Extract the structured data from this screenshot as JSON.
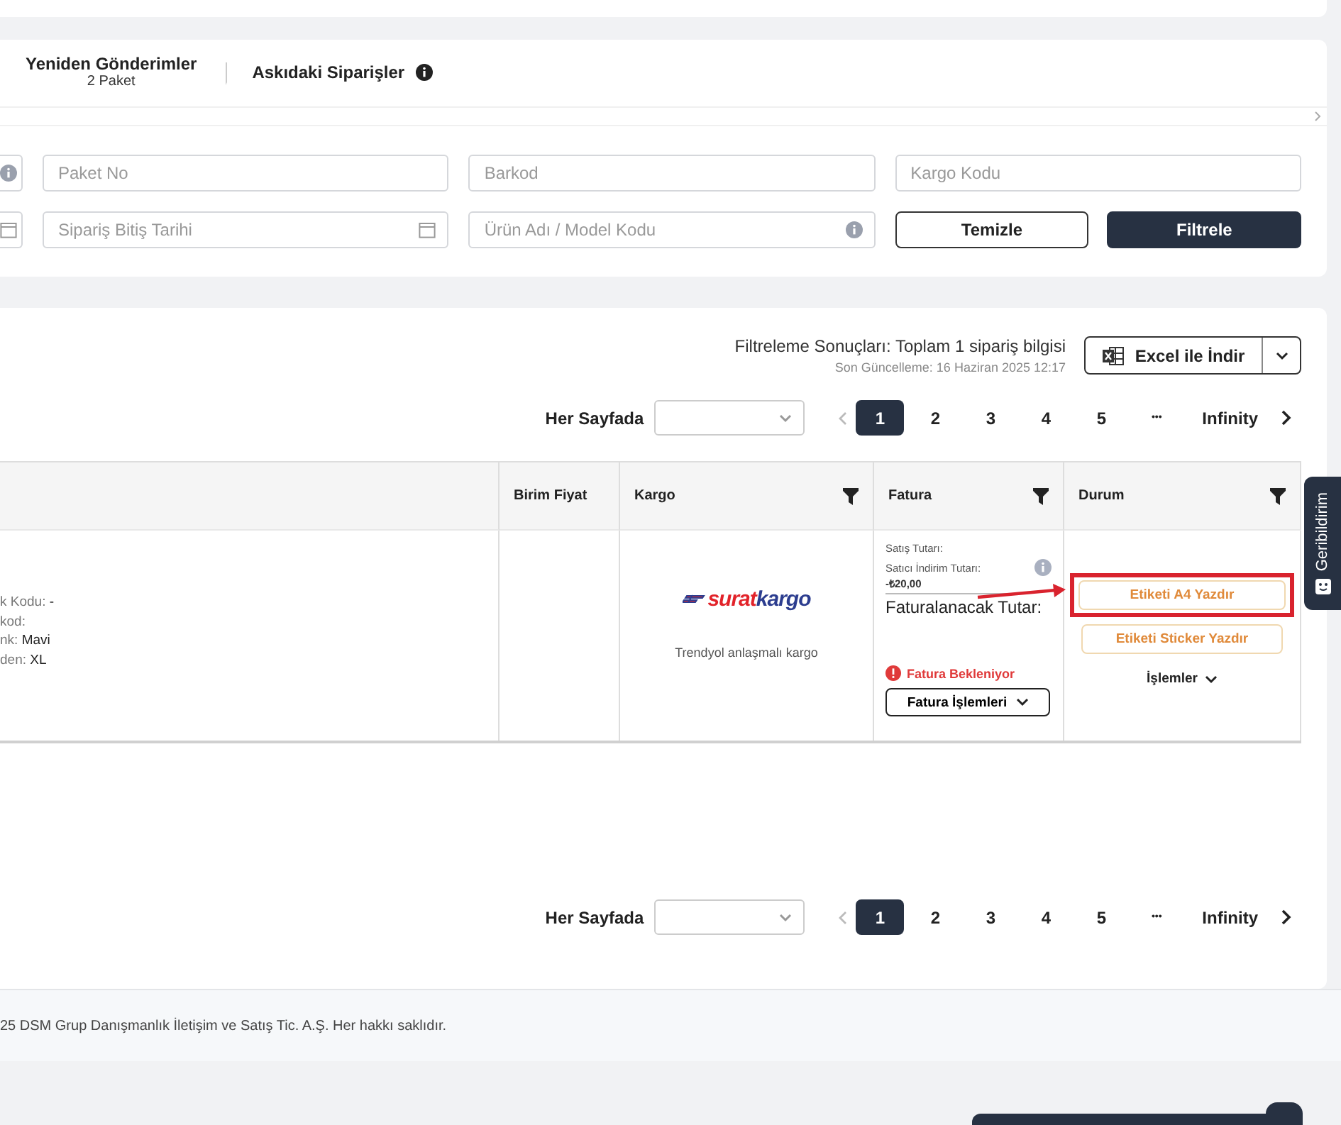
{
  "tabs": [
    {
      "kind": "count",
      "label": "Yeniden Gönderimler",
      "count": "2 Paket",
      "selected": false
    },
    {
      "kind": "info",
      "label": "Askıdaki Siparişler",
      "selected": false
    }
  ],
  "filters": [
    [
      {
        "kind": "cut_info"
      },
      {
        "kind": "text",
        "placeholder": "Paket No"
      },
      {
        "kind": "text",
        "placeholder": "Barkod"
      },
      {
        "kind": "text",
        "placeholder": "Kargo Kodu"
      }
    ],
    [
      {
        "kind": "cut_date"
      },
      {
        "kind": "date",
        "placeholder": "Sipariş Bitiş Tarihi"
      },
      {
        "kind": "info",
        "placeholder": "Ürün Adı / Model Kodu"
      },
      {
        "kind": "buttons",
        "buttons": [
          {
            "kind": "secondary",
            "label": "Temizle"
          },
          {
            "kind": "primary",
            "label": "Filtrele"
          }
        ]
      }
    ]
  ],
  "results": {
    "summary": "Filtreleme Sonuçları: Toplam 1 sipariş bilgisi",
    "updated": "Son Güncelleme: 16 Haziran 2025 12:17",
    "export_button": "Excel ile İndir"
  },
  "paginations": [
    {
      "per_page_label": "Her Sayfada",
      "pages": [
        {
          "kind": "page",
          "label": "1",
          "selected": true
        },
        {
          "kind": "page",
          "label": "2",
          "selected": false
        },
        {
          "kind": "page",
          "label": "3",
          "selected": false
        },
        {
          "kind": "page",
          "label": "4",
          "selected": false
        },
        {
          "kind": "page",
          "label": "5",
          "selected": false
        },
        {
          "kind": "ellipsis",
          "label": "•••",
          "selected": false
        },
        {
          "kind": "page",
          "label": "Infinity",
          "selected": false
        }
      ]
    },
    {
      "per_page_label": "Her Sayfada",
      "pages": [
        {
          "kind": "page",
          "label": "1",
          "selected": true
        },
        {
          "kind": "page",
          "label": "2",
          "selected": false
        },
        {
          "kind": "page",
          "label": "3",
          "selected": false
        },
        {
          "kind": "page",
          "label": "4",
          "selected": false
        },
        {
          "kind": "page",
          "label": "5",
          "selected": false
        },
        {
          "kind": "ellipsis",
          "label": "•••",
          "selected": false
        },
        {
          "kind": "page",
          "label": "Infinity",
          "selected": false
        }
      ]
    }
  ],
  "table": {
    "columns": [
      {
        "kind": "blank"
      },
      {
        "kind": "plain",
        "label": "Birim Fiyat"
      },
      {
        "kind": "filterable",
        "label": "Kargo"
      },
      {
        "kind": "filterable",
        "label": "Fatura"
      },
      {
        "kind": "filterable",
        "label": "Durum"
      }
    ],
    "row": {
      "column_1": [
        {
          "label": "k Kodu:",
          "value": "-"
        },
        {
          "label": "kod:"
        },
        {
          "label": "nk:",
          "value": "Mavi"
        },
        {
          "label": "den:",
          "value": "XL"
        }
      ],
      "cargo": {
        "logo": [
          "surat",
          "kargo"
        ],
        "note": "Trendyol anlaşmalı kargo"
      },
      "invoice": {
        "sale_label": "Satış Tutarı:",
        "discount_label": "Satıcı İndirim Tutarı:",
        "discount_value": "-₺20,00",
        "total_label": "Faturalanacak Tutar:",
        "status": "Fatura Bekleniyor",
        "menu": "Fatura İşlemleri"
      },
      "status": {
        "buttons": [
          {
            "label": "Etiketi A4 Yazdır",
            "highlighted": true
          },
          {
            "label": "Etiketi Sticker Yazdır",
            "highlighted": false
          }
        ],
        "menu": "İşlemler"
      }
    }
  },
  "footer": "25 DSM Grup Danışmanlık İletişim ve Satış Tic. A.Ş. Her hakkı saklıdır.",
  "feedback_tab": "Geribildirim"
}
